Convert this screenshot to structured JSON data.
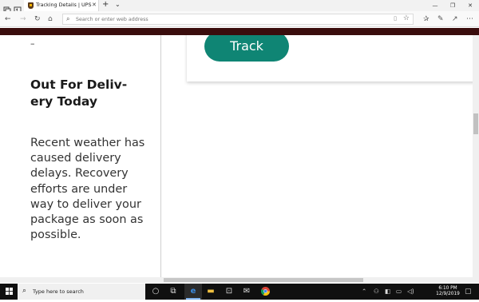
{
  "browser": {
    "tab_title": "Tracking Details | UPS",
    "tab_close": "✕",
    "new_tab": "+",
    "tab_menu": "⌄",
    "window_controls": [
      "—",
      "❐",
      "✕"
    ],
    "address_placeholder": "Search or enter web address"
  },
  "page": {
    "dash": "–",
    "headline": "Out For Deliv­ery Today",
    "body": "Recent weather has caused delivery delays. Recovery efforts are under way to deliver your package as soon as possible.",
    "track_button": "Track"
  },
  "taskbar": {
    "search_placeholder": "Type here to search",
    "time": "6:10 PM",
    "date": "12/9/2019"
  }
}
